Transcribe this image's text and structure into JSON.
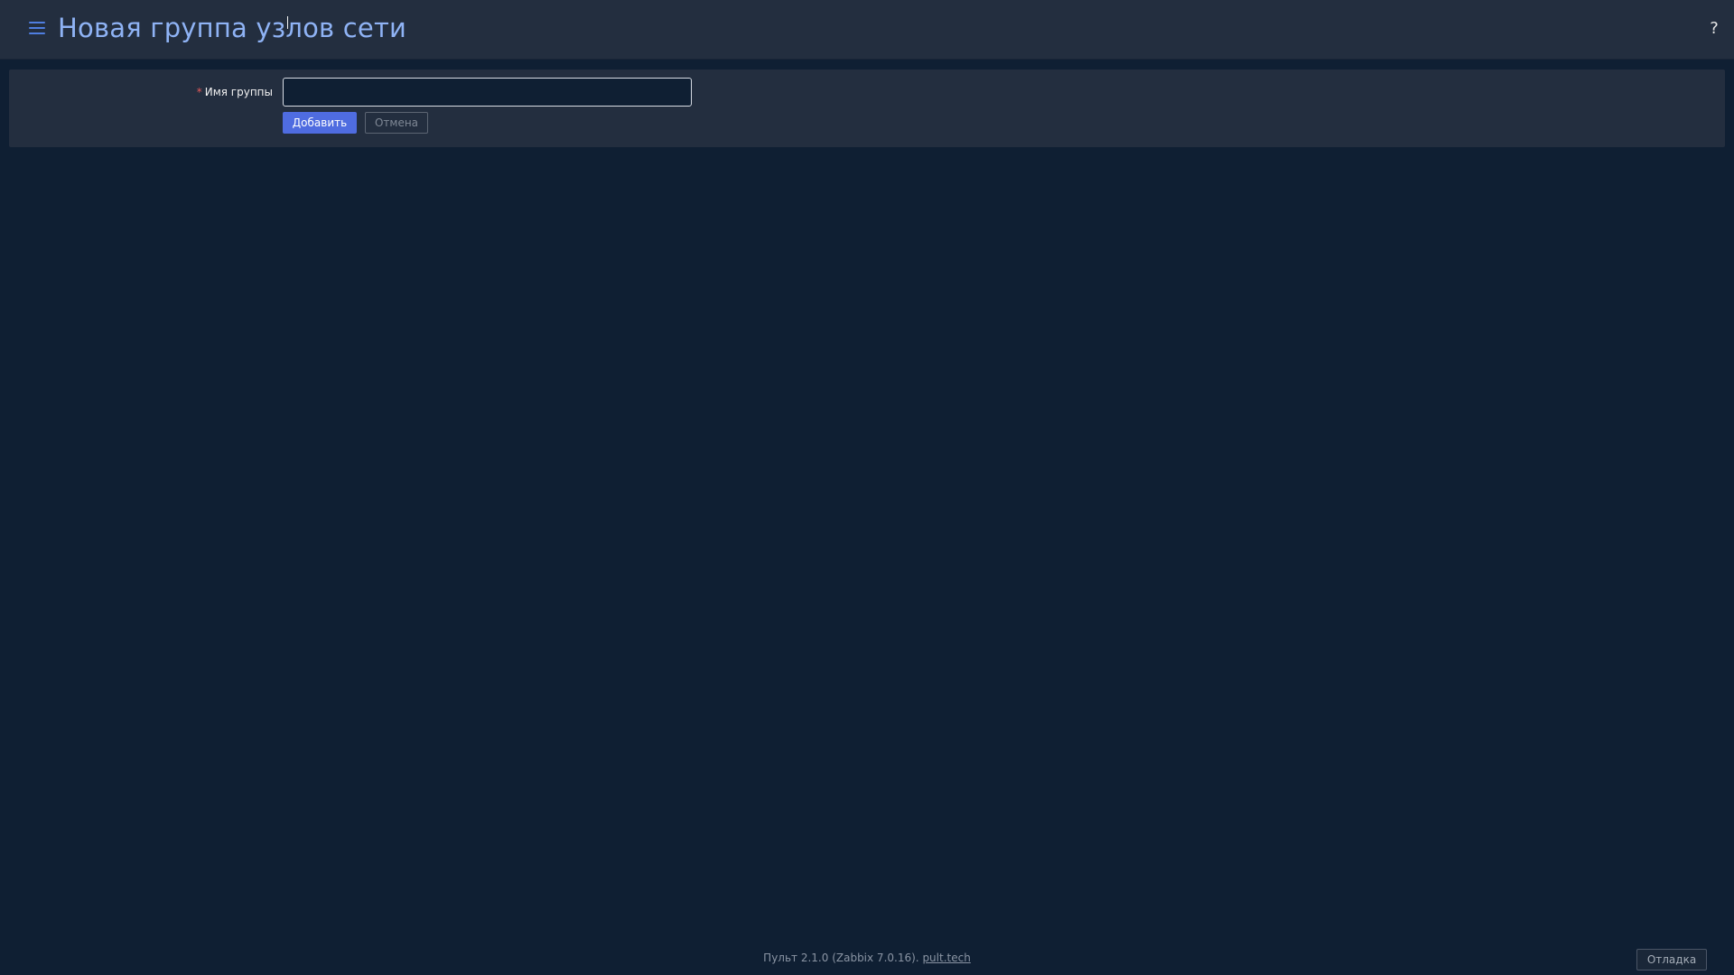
{
  "header": {
    "title": "Новая группа узлов сети",
    "help_label": "?",
    "menu_icon": "hamburger-menu-icon"
  },
  "form": {
    "required_mark": "*",
    "group_name_label": "Имя группы",
    "group_name_value": "",
    "add_label": "Добавить",
    "cancel_label": "Отмена"
  },
  "footer": {
    "version_text": "Пульт 2.1.0 (Zabbix 7.0.16).",
    "link_text": "pult.tech",
    "debug_label": "Отладка"
  },
  "colors": {
    "background": "#0f1f33",
    "header_bg": "#232e3f",
    "title": "#8fb3f5",
    "accent": "#4f6ce0",
    "required": "#e45959"
  }
}
